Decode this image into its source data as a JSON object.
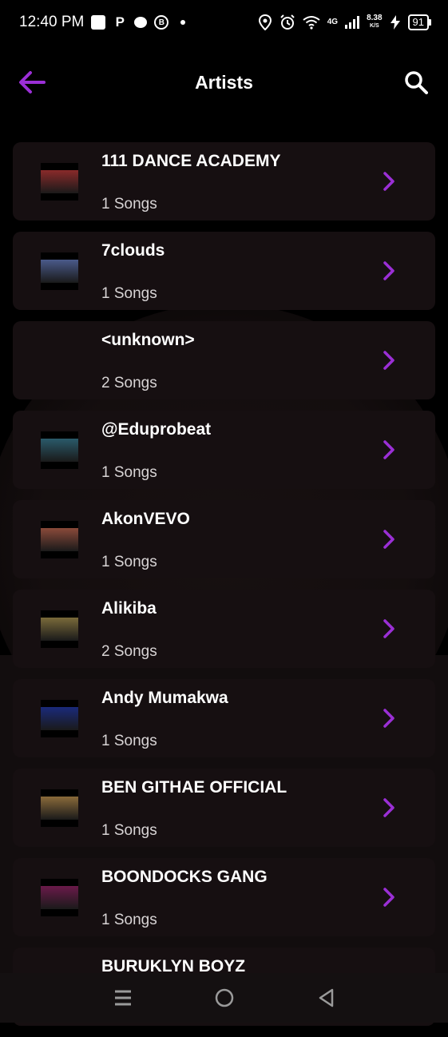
{
  "status_bar": {
    "time": "12:40 PM",
    "network": "4G",
    "speed_value": "8.38",
    "speed_unit": "K/S",
    "battery": "91"
  },
  "header": {
    "title": "Artists",
    "back_icon": "arrow-left-icon",
    "search_icon": "search-icon"
  },
  "colors": {
    "accent": "#9b2fd6",
    "row_bg": "#160f11"
  },
  "artists": [
    {
      "name": "111 DANCE ACADEMY",
      "songs": "1 Songs",
      "thumb": "#8a2a2a"
    },
    {
      "name": "7clouds",
      "songs": "1 Songs",
      "thumb": "#4a5a8a"
    },
    {
      "name": "<unknown>",
      "songs": "2 Songs",
      "thumb": ""
    },
    {
      "name": "@Eduprobeat",
      "songs": "1 Songs",
      "thumb": "#2a5a6a"
    },
    {
      "name": "AkonVEVO",
      "songs": "1 Songs",
      "thumb": "#8a4a3a"
    },
    {
      "name": "Alikiba",
      "songs": "2 Songs",
      "thumb": "#7a6a3a"
    },
    {
      "name": "Andy Mumakwa",
      "songs": "1 Songs",
      "thumb": "#1a2a7a"
    },
    {
      "name": "BEN GITHAE OFFICIAL",
      "songs": "1 Songs",
      "thumb": "#8a6a3a"
    },
    {
      "name": "BOONDOCKS GANG",
      "songs": "1 Songs",
      "thumb": "#6a1a4a"
    },
    {
      "name": "BURUKLYN BOYZ",
      "songs": "",
      "thumb": ""
    }
  ],
  "nav": {
    "recents_icon": "menu-icon",
    "home_icon": "circle-home-icon",
    "back_icon": "triangle-back-icon"
  }
}
